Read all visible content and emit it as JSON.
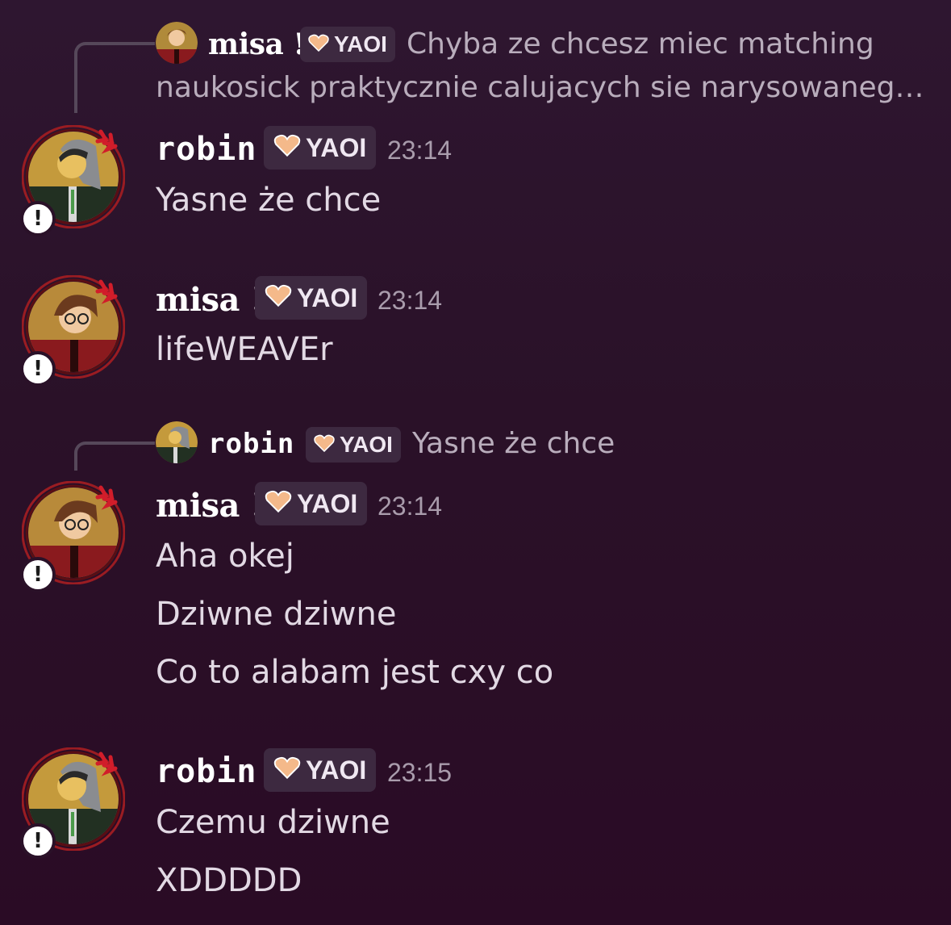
{
  "tag": {
    "label": "YAOI",
    "icon": "heart-icon",
    "color": "#f4b98a"
  },
  "messages": [
    {
      "reply": {
        "author": "misa !",
        "tag": "YAOI",
        "text_line1": "Chyba ze chcesz miec matching",
        "text_line2": "naukosick praktycznie calujacych sie narysowaneg…"
      },
      "author": "robin",
      "tag": "YAOI",
      "time": "23:14",
      "lines": [
        "Yasne że chce"
      ]
    },
    {
      "author": "misa !",
      "tag": "YAOI",
      "time": "23:14",
      "lines": [
        "lifeWEAVEr"
      ]
    },
    {
      "reply": {
        "author": "robin",
        "tag": "YAOI",
        "text_line1": "Yasne że chce"
      },
      "author": "misa !",
      "tag": "YAOI",
      "time": "23:14",
      "lines": [
        "Aha okej",
        "Dziwne dziwne",
        "Co to alabam jest cxy co"
      ]
    },
    {
      "author": "robin",
      "tag": "YAOI",
      "time": "23:15",
      "lines": [
        "Czemu dziwne",
        "XDDDDD"
      ]
    }
  ]
}
